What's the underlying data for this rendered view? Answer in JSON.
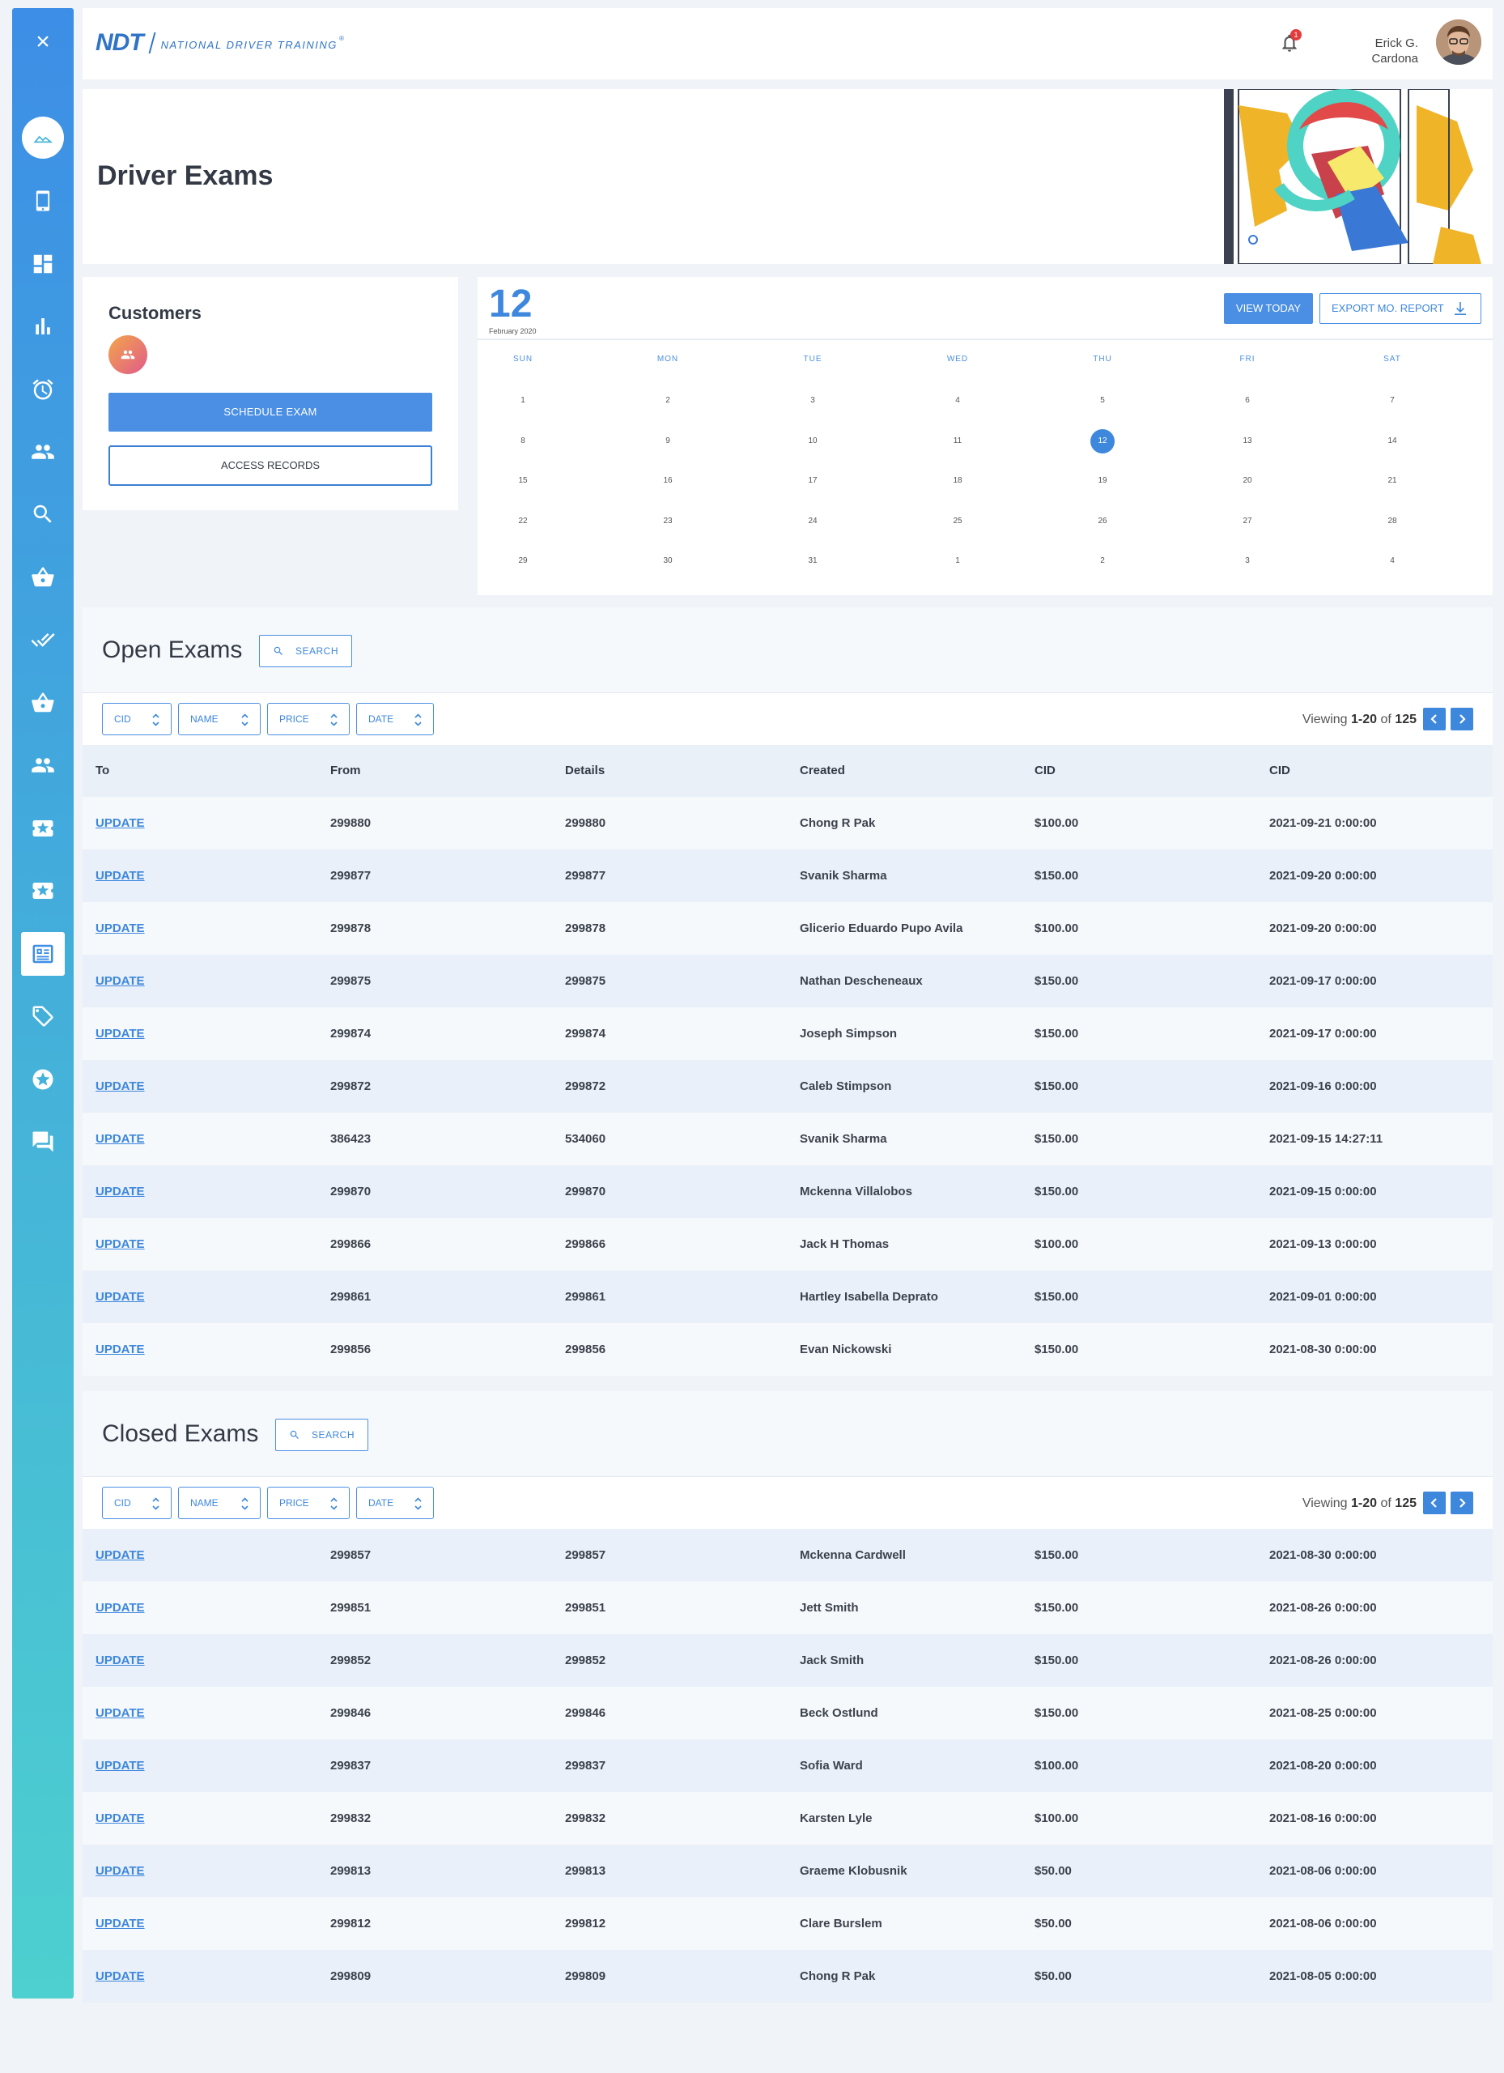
{
  "header": {
    "logo_abbr": "NDT",
    "logo_text": "NATIONAL DRIVER TRAINING",
    "logo_reg": "®",
    "notification_count": "1",
    "user_name_line1": "Erick G.",
    "user_name_line2": "Cardona"
  },
  "sidebar": {
    "close_icon": "×",
    "items": [
      "home-icon",
      "phone-icon",
      "dashboard-icon",
      "bar-chart-icon",
      "alarm-icon",
      "people-icon",
      "search-icon",
      "basket-icon",
      "double-check-icon",
      "basket-icon",
      "people-icon",
      "ticket-icon",
      "ticket-icon",
      "exam-list-icon",
      "tag-icon",
      "star-badge-icon",
      "chat-icon"
    ]
  },
  "page": {
    "title": "Driver Exams"
  },
  "customers": {
    "title": "Customers",
    "schedule_label": "SCHEDULE EXAM",
    "access_label": "ACCESS RECORDS"
  },
  "calendar": {
    "day": "12",
    "month_year": "February 2020",
    "view_today_label": "VIEW TODAY",
    "export_label": "EXPORT MO. REPORT",
    "weekdays": [
      "SUN",
      "MON",
      "TUE",
      "WED",
      "THU",
      "FRI",
      "SAT"
    ],
    "weeks": [
      [
        "1",
        "2",
        "3",
        "4",
        "5",
        "6",
        "7"
      ],
      [
        "8",
        "9",
        "10",
        "11",
        "12",
        "13",
        "14"
      ],
      [
        "15",
        "16",
        "17",
        "18",
        "19",
        "20",
        "21"
      ],
      [
        "22",
        "23",
        "24",
        "25",
        "26",
        "27",
        "28"
      ],
      [
        "29",
        "30",
        "31",
        "1",
        "2",
        "3",
        "4"
      ]
    ],
    "selected": "12"
  },
  "open_exams": {
    "title": "Open Exams",
    "search_label": "SEARCH",
    "filters": [
      "CID",
      "NAME",
      "PRICE",
      "DATE"
    ],
    "viewing_prefix": "Viewing",
    "viewing_range": "1-20",
    "viewing_of": "of",
    "viewing_total": "125",
    "columns": [
      "To",
      "From",
      "Details",
      "Created",
      "CID",
      "CID"
    ],
    "rows": [
      [
        "UPDATE",
        "299880",
        "299880",
        "Chong R Pak",
        "$100.00",
        "2021-09-21 0:00:00"
      ],
      [
        "UPDATE",
        "299877",
        "299877",
        "Svanik Sharma",
        "$150.00",
        "2021-09-20 0:00:00"
      ],
      [
        "UPDATE",
        "299878",
        "299878",
        "Glicerio Eduardo Pupo Avila",
        "$100.00",
        "2021-09-20 0:00:00"
      ],
      [
        "UPDATE",
        "299875",
        "299875",
        "Nathan Descheneaux",
        "$150.00",
        "2021-09-17 0:00:00"
      ],
      [
        "UPDATE",
        "299874",
        "299874",
        "Joseph Simpson",
        "$150.00",
        "2021-09-17 0:00:00"
      ],
      [
        "UPDATE",
        "299872",
        "299872",
        "Caleb Stimpson",
        "$150.00",
        "2021-09-16 0:00:00"
      ],
      [
        "UPDATE",
        "386423",
        "534060",
        "Svanik Sharma",
        "$150.00",
        "2021-09-15 14:27:11"
      ],
      [
        "UPDATE",
        "299870",
        "299870",
        "Mckenna Villalobos",
        "$150.00",
        "2021-09-15 0:00:00"
      ],
      [
        "UPDATE",
        "299866",
        "299866",
        "Jack H Thomas",
        "$100.00",
        "2021-09-13 0:00:00"
      ],
      [
        "UPDATE",
        "299861",
        "299861",
        "Hartley Isabella Deprato",
        "$150.00",
        "2021-09-01 0:00:00"
      ],
      [
        "UPDATE",
        "299856",
        "299856",
        "Evan Nickowski",
        "$150.00",
        "2021-08-30 0:00:00"
      ]
    ]
  },
  "closed_exams": {
    "title": "Closed Exams",
    "search_label": "SEARCH",
    "filters": [
      "CID",
      "NAME",
      "PRICE",
      "DATE"
    ],
    "viewing_prefix": "Viewing",
    "viewing_range": "1-20",
    "viewing_of": "of",
    "viewing_total": "125",
    "rows": [
      [
        "UPDATE",
        "299857",
        "299857",
        "Mckenna Cardwell",
        "$150.00",
        "2021-08-30 0:00:00"
      ],
      [
        "UPDATE",
        "299851",
        "299851",
        "Jett Smith",
        "$150.00",
        "2021-08-26 0:00:00"
      ],
      [
        "UPDATE",
        "299852",
        "299852",
        "Jack Smith",
        "$150.00",
        "2021-08-26 0:00:00"
      ],
      [
        "UPDATE",
        "299846",
        "299846",
        "Beck Ostlund",
        "$150.00",
        "2021-08-25 0:00:00"
      ],
      [
        "UPDATE",
        "299837",
        "299837",
        "Sofia Ward",
        "$100.00",
        "2021-08-20 0:00:00"
      ],
      [
        "UPDATE",
        "299832",
        "299832",
        "Karsten Lyle",
        "$100.00",
        "2021-08-16 0:00:00"
      ],
      [
        "UPDATE",
        "299813",
        "299813",
        "Graeme Klobusnik",
        "$50.00",
        "2021-08-06 0:00:00"
      ],
      [
        "UPDATE",
        "299812",
        "299812",
        "Clare Burslem",
        "$50.00",
        "2021-08-06 0:00:00"
      ],
      [
        "UPDATE",
        "299809",
        "299809",
        "Chong R Pak",
        "$50.00",
        "2021-08-05 0:00:00"
      ]
    ]
  },
  "colors": {
    "accent": "#3d87dd",
    "sidebar_top": "#3d8ee6",
    "sidebar_bottom": "#4dd0cf",
    "badge": "#e53b3b"
  }
}
